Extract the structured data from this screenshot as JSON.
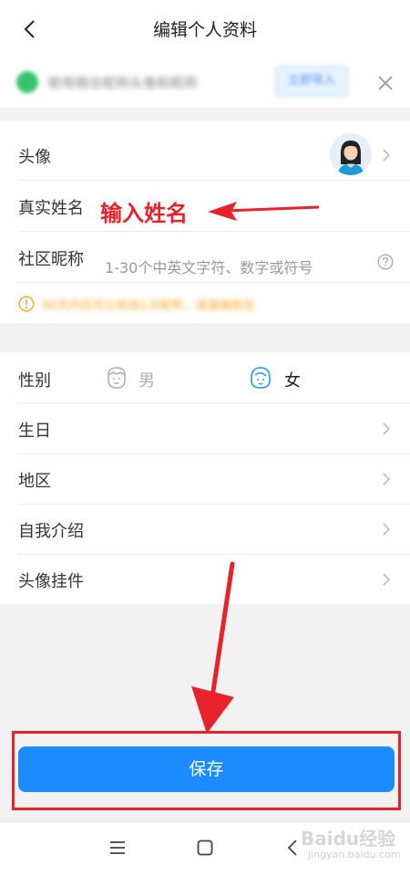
{
  "header": {
    "title": "编辑个人资料"
  },
  "banner": {
    "text": "使用微信昵称头像和昵称",
    "button_label": "立即导入"
  },
  "profile": {
    "avatar_label": "头像",
    "real_name_label": "真实姓名",
    "annotation": "输入姓名",
    "nickname_label": "社区昵称",
    "nickname_placeholder": "1-30个中英文字符、数字或符号",
    "notice": "90天内仅可以修改1次昵称，请谨慎修改"
  },
  "details": {
    "gender_label": "性别",
    "gender_male": "男",
    "gender_female": "女",
    "gender_selected": "女",
    "birthday_label": "生日",
    "region_label": "地区",
    "intro_label": "自我介绍",
    "avatar_pendant_label": "头像挂件"
  },
  "save_label": "保存",
  "watermark": {
    "logo": "Baidu经验",
    "url": "jingyan.baidu.com"
  },
  "colors": {
    "accent": "#1a8cff",
    "annotation_red": "#e8222a",
    "notice_orange": "#f5a623",
    "selected_female": "#3aa0f0"
  }
}
